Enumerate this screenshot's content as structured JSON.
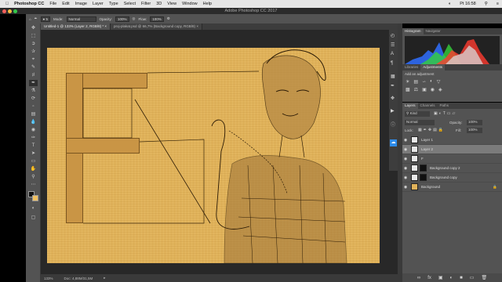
{
  "menubar": {
    "apple": "",
    "app_name": "Photoshop CC",
    "items": [
      "File",
      "Edit",
      "Image",
      "Layer",
      "Type",
      "Select",
      "Filter",
      "3D",
      "View",
      "Window",
      "Help"
    ],
    "clock": "Pt 16:58"
  },
  "window": {
    "title": "Adobe Photoshop CC 2017"
  },
  "options_bar": {
    "mode_label": "Mode:",
    "mode_value": "Normal",
    "opacity_label": "Opacity:",
    "opacity_value": "100%",
    "flow_label": "Flow:",
    "flow_value": "100%"
  },
  "documents": {
    "tabs": [
      {
        "label": "Untitled-1 @ 133% (Layer 2, RGB/8) *"
      },
      {
        "label": "proj-plakat.psd @ 66,7% (Background copy, RGB/8)"
      }
    ]
  },
  "status": {
    "zoom": "133%",
    "doc": "Doc: 4,88M/31,5M"
  },
  "panels": {
    "histogram_tabs": [
      "Histogram",
      "Navigator"
    ],
    "adjust_tabs": [
      "Libraries",
      "Adjustments"
    ],
    "adjust_hint": "Add an adjustment",
    "layers_tabs": [
      "Layers",
      "Channels",
      "Paths"
    ],
    "kind_label": "Kind",
    "blend_mode": "Normal",
    "opacity_label": "Opacity:",
    "opacity_value": "100%",
    "lock_label": "Lock:",
    "fill_label": "Fill:",
    "fill_value": "100%"
  },
  "layers": [
    {
      "name": "Layer 1",
      "selected": false
    },
    {
      "name": "Layer 2",
      "selected": true
    },
    {
      "name": "F",
      "selected": false
    },
    {
      "name": "Background copy 2",
      "selected": false
    },
    {
      "name": "Background copy",
      "selected": false
    },
    {
      "name": "Background",
      "selected": false
    }
  ],
  "colors": {
    "canvas_fill": "#e0b25a",
    "accent": "#2d8ceb"
  }
}
